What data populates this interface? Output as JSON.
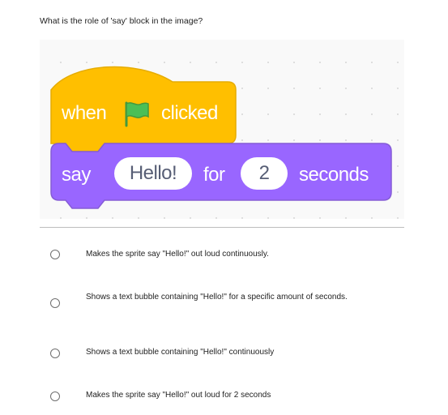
{
  "question": "What is the role of 'say' block in the image?",
  "blocks": {
    "hat": {
      "word_when": "when",
      "flag_icon": "green-flag-icon",
      "word_clicked": "clicked",
      "color": "#FFBF00",
      "border_color": "#E6AC00"
    },
    "say": {
      "word_say": "say",
      "message": "Hello!",
      "word_for": "for",
      "seconds_value": "2",
      "word_seconds": "seconds",
      "color": "#9966FF",
      "border_color": "#855CD6"
    }
  },
  "options": [
    {
      "label": "Makes the sprite say \"Hello!\" out loud continuously."
    },
    {
      "label": "Shows a text bubble containing \"Hello!\" for a specific amount of seconds."
    },
    {
      "label": "Shows a text bubble containing \"Hello!\" continuously"
    },
    {
      "label": "Makes the sprite say \"Hello!\" out loud for 2 seconds"
    }
  ]
}
